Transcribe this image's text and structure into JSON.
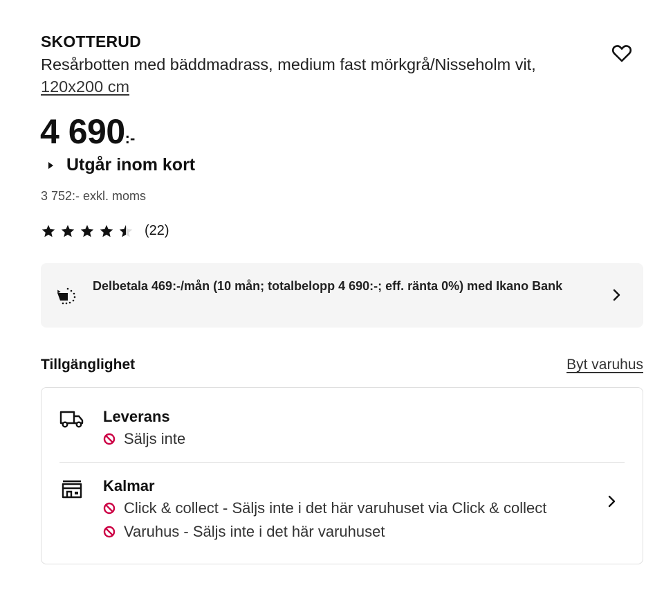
{
  "product": {
    "name": "SKOTTERUD",
    "description_prefix": "Resårbotten med bäddmadrass, medium fast mörkgrå/Nisseholm vit, ",
    "size_link": "120x200 cm",
    "price_main": "4 690",
    "price_suffix": ":-",
    "discontinued_label": "Utgår inom kort",
    "price_excl_vat": "3 752:- exkl. moms",
    "rating": 4.5,
    "rating_count": "(22)"
  },
  "financing": {
    "text": "Delbetala 469:-/mån (10 mån; totalbelopp 4 690:-; eff. ränta 0%) med Ikano Bank"
  },
  "availability": {
    "title": "Tillgänglighet",
    "change_store": "Byt varuhus",
    "delivery": {
      "title": "Leverans",
      "status": "Säljs inte"
    },
    "store": {
      "title": "Kalmar",
      "statuses": [
        "Click & collect - Säljs inte i det här varuhuset via Click & collect",
        "Varuhus - Säljs inte i det här varuhuset"
      ]
    }
  },
  "colors": {
    "text": "#111111",
    "muted": "#484848",
    "unavailable": "#cc0044",
    "promo_bg": "#f5f5f5",
    "border": "#dfdfdf"
  },
  "icons": {
    "favorite": "heart-icon",
    "financing": "piggy-bank-icon",
    "delivery": "truck-icon",
    "store": "store-icon",
    "unavailable": "no-entry-icon",
    "chevron": "chevron-right-icon",
    "expand": "triangle-right-icon"
  }
}
